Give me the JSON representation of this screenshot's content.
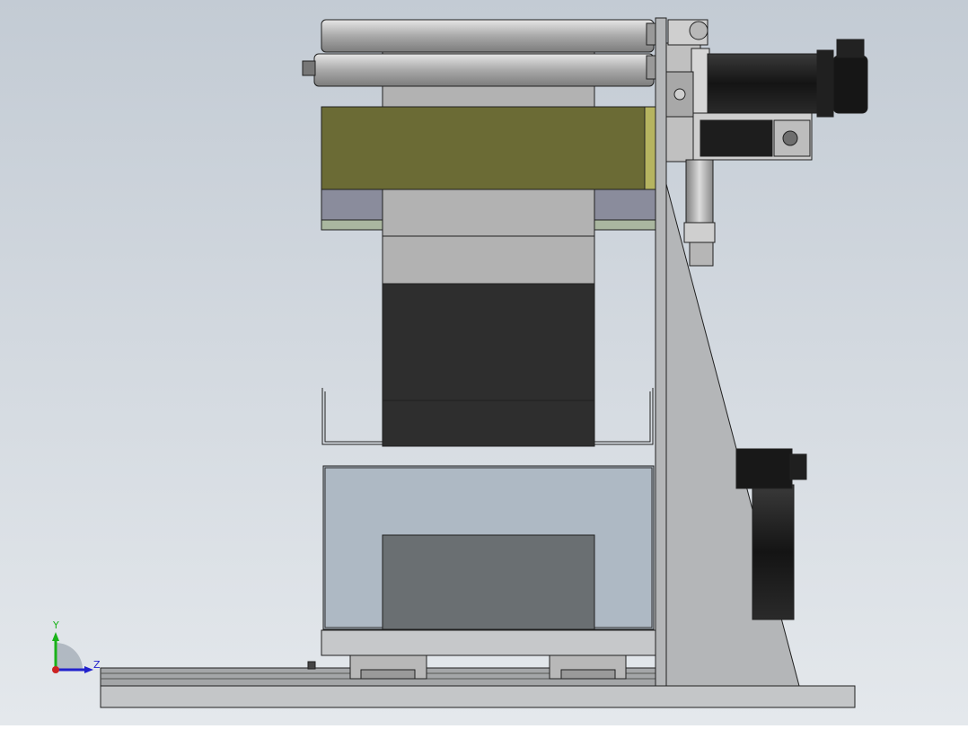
{
  "viewport": {
    "background_top": "#c3cbd4",
    "background_bottom": "#e4e8ec"
  },
  "triad": {
    "y_label": "Y",
    "z_label": "Z",
    "y_color": "#19b219",
    "z_color": "#2222cc",
    "x_color": "#cc2222"
  },
  "colors": {
    "frame": "#b4b6b8",
    "steel_light": "#c8c8c8",
    "olive": "#6b6b35",
    "dark_block": "#2e2e2e",
    "motor_black": "#1e1e1e",
    "glass_box": "#aeb9c4",
    "dark_grey_block": "#6a6f72",
    "purple_band": "#8a8c9c",
    "green_band": "#aab7a0",
    "edge": "#202020"
  }
}
